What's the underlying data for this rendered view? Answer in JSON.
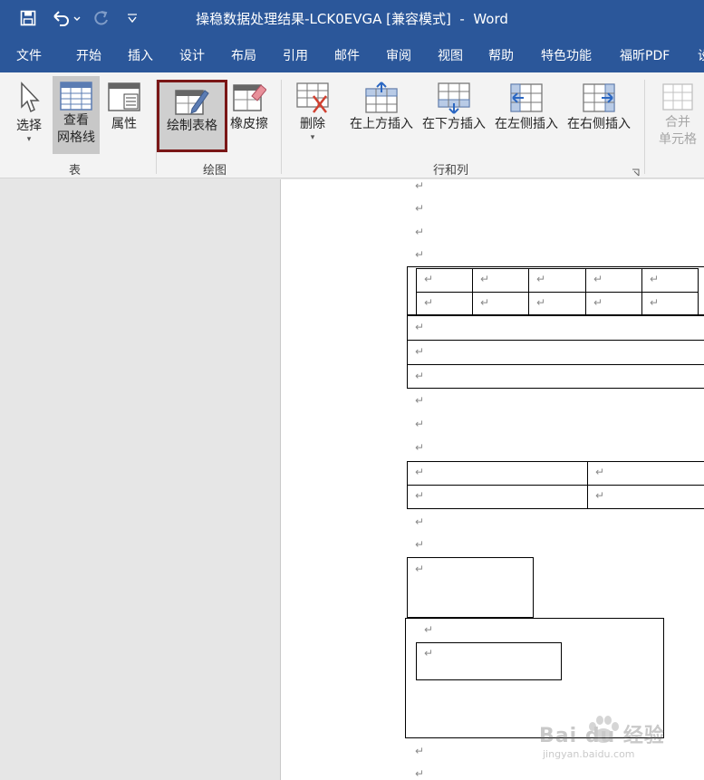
{
  "window": {
    "title": "操稳数据处理结果-LCK0EVGA [兼容模式]  -  Word"
  },
  "quick_access": [
    "save-icon",
    "undo-icon",
    "redo-icon",
    "customize-icon"
  ],
  "tabs": [
    "文件",
    "开始",
    "插入",
    "设计",
    "布局",
    "引用",
    "邮件",
    "审阅",
    "视图",
    "帮助",
    "特色功能",
    "福昕PDF",
    "设"
  ],
  "ribbon": {
    "select_label": "选择",
    "gridlines_label_1": "查看",
    "gridlines_label_2": "网格线",
    "properties_label": "属性",
    "draw_table_label": "绘制表格",
    "eraser_label": "橡皮擦",
    "delete_label": "删除",
    "insert_above_label": "在上方插入",
    "insert_below_label": "在下方插入",
    "insert_left_label": "在左侧插入",
    "insert_right_label": "在右侧插入",
    "merge_label_1": "合并",
    "merge_label_2": "单元格",
    "group_table": "表",
    "group_draw": "绘图",
    "group_rows_cols": "行和列"
  },
  "document": {
    "paragraph_mark": "↵"
  },
  "watermark": {
    "brand": "Bai du 经验",
    "url": "jingyan.baidu.com"
  },
  "colors": {
    "title_bar": "#2b579a",
    "ribbon_bg": "#f3f3f3",
    "selected_button_border": "#7a1717"
  }
}
